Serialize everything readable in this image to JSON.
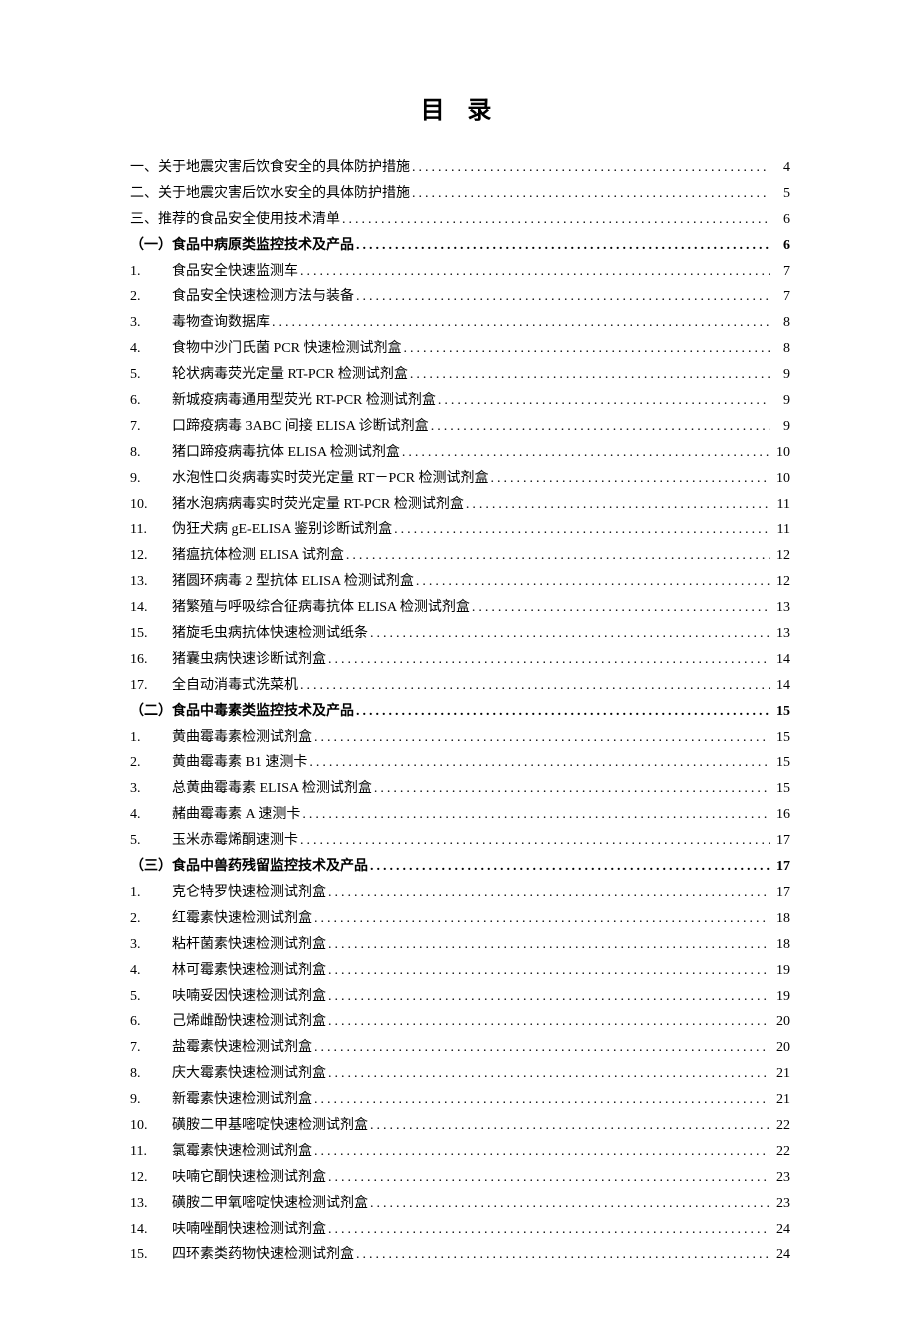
{
  "title": "目 录",
  "entries": [
    {
      "num": "一、",
      "label": "关于地震灾害后饮食安全的具体防护措施",
      "page": "4",
      "cls": "top-level"
    },
    {
      "num": "二、",
      "label": "关于地震灾害后饮水安全的具体防护措施",
      "page": "5",
      "cls": "top-level"
    },
    {
      "num": "三、",
      "label": "推荐的食品安全使用技术清单",
      "page": "6",
      "cls": "top-level"
    },
    {
      "num": "",
      "label": "（一）食品中病原类监控技术及产品",
      "page": "6",
      "cls": "section-heading"
    },
    {
      "num": "1.",
      "label": "食品安全快速监测车",
      "page": "7"
    },
    {
      "num": "2.",
      "label": "食品安全快速检测方法与装备",
      "page": "7"
    },
    {
      "num": "3.",
      "label": "毒物查询数据库",
      "page": "8"
    },
    {
      "num": "4.",
      "label": "食物中沙门氏菌 PCR 快速检测试剂盒",
      "page": "8"
    },
    {
      "num": "5.",
      "label": "轮状病毒荧光定量 RT-PCR 检测试剂盒",
      "page": "9"
    },
    {
      "num": "6.",
      "label": "新城疫病毒通用型荧光 RT-PCR 检测试剂盒",
      "page": "9"
    },
    {
      "num": "7.",
      "label": "口蹄疫病毒 3ABC 间接 ELISA 诊断试剂盒",
      "page": "9"
    },
    {
      "num": "8.",
      "label": "猪口蹄疫病毒抗体 ELISA 检测试剂盒",
      "page": "10"
    },
    {
      "num": "9.",
      "label": "水泡性口炎病毒实时荧光定量 RT－PCR 检测试剂盒",
      "page": "10"
    },
    {
      "num": "10.",
      "label": "猪水泡病病毒实时荧光定量 RT-PCR 检测试剂盒",
      "page": "11"
    },
    {
      "num": "11.",
      "label": "伪狂犬病 gE-ELISA 鉴别诊断试剂盒",
      "page": "11"
    },
    {
      "num": "12.",
      "label": "猪瘟抗体检测 ELISA 试剂盒",
      "page": "12"
    },
    {
      "num": "13.",
      "label": "猪圆环病毒 2 型抗体 ELISA 检测试剂盒",
      "page": "12"
    },
    {
      "num": "14.",
      "label": "猪繁殖与呼吸综合征病毒抗体 ELISA 检测试剂盒",
      "page": "13"
    },
    {
      "num": "15.",
      "label": "猪旋毛虫病抗体快速检测试纸条",
      "page": "13"
    },
    {
      "num": "16.",
      "label": "猪囊虫病快速诊断试剂盒",
      "page": "14"
    },
    {
      "num": "17.",
      "label": "全自动消毒式洗菜机",
      "page": "14"
    },
    {
      "num": "",
      "label": "（二）食品中毒素类监控技术及产品",
      "page": "15",
      "cls": "section-heading"
    },
    {
      "num": "1.",
      "label": "黄曲霉毒素检测试剂盒",
      "page": "15"
    },
    {
      "num": "2.",
      "label": "黄曲霉毒素 B1 速测卡",
      "page": "15"
    },
    {
      "num": "3.",
      "label": "总黄曲霉毒素 ELISA 检测试剂盒",
      "page": "15"
    },
    {
      "num": "4.",
      "label": "赭曲霉毒素 A 速测卡",
      "page": "16"
    },
    {
      "num": "5.",
      "label": "玉米赤霉烯酮速测卡",
      "page": "17"
    },
    {
      "num": "",
      "label": "（三）食品中兽药残留监控技术及产品",
      "page": "17",
      "cls": "section-heading"
    },
    {
      "num": "1.",
      "label": "克仑特罗快速检测试剂盒",
      "page": "17"
    },
    {
      "num": "2.",
      "label": "红霉素快速检测试剂盒",
      "page": "18"
    },
    {
      "num": "3.",
      "label": "粘杆菌素快速检测试剂盒",
      "page": "18"
    },
    {
      "num": "4.",
      "label": "林可霉素快速检测试剂盒",
      "page": "19"
    },
    {
      "num": "5.",
      "label": "呋喃妥因快速检测试剂盒",
      "page": "19"
    },
    {
      "num": "6.",
      "label": "己烯雌酚快速检测试剂盒",
      "page": "20"
    },
    {
      "num": "7.",
      "label": "盐霉素快速检测试剂盒",
      "page": "20"
    },
    {
      "num": "8.",
      "label": "庆大霉素快速检测试剂盒",
      "page": "21"
    },
    {
      "num": "9.",
      "label": "新霉素快速检测试剂盒",
      "page": "21"
    },
    {
      "num": "10.",
      "label": "磺胺二甲基嘧啶快速检测试剂盒",
      "page": "22"
    },
    {
      "num": "11.",
      "label": "氯霉素快速检测试剂盒",
      "page": "22"
    },
    {
      "num": "12.",
      "label": "呋喃它酮快速检测试剂盒",
      "page": "23"
    },
    {
      "num": "13.",
      "label": "磺胺二甲氧嘧啶快速检测试剂盒",
      "page": "23"
    },
    {
      "num": "14.",
      "label": "呋喃唑酮快速检测试剂盒",
      "page": "24"
    },
    {
      "num": "15.",
      "label": "四环素类药物快速检测试剂盒",
      "page": "24"
    }
  ]
}
